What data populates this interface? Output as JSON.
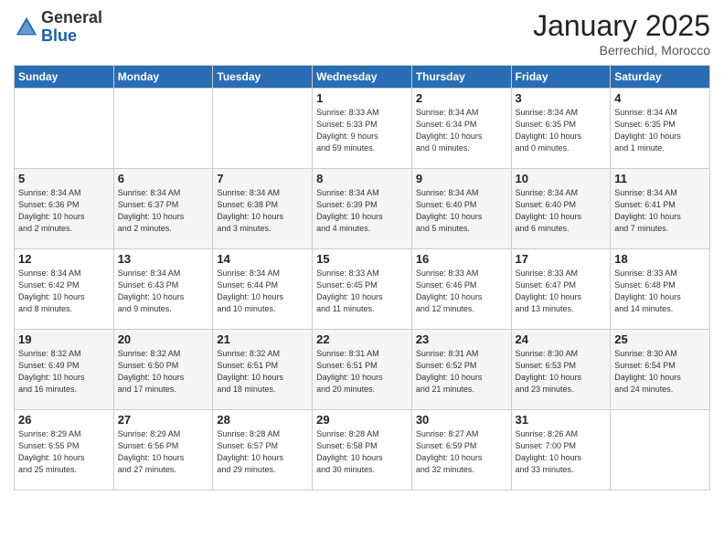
{
  "logo": {
    "general": "General",
    "blue": "Blue"
  },
  "header": {
    "month_year": "January 2025",
    "location": "Berrechid, Morocco"
  },
  "days_of_week": [
    "Sunday",
    "Monday",
    "Tuesday",
    "Wednesday",
    "Thursday",
    "Friday",
    "Saturday"
  ],
  "weeks": [
    [
      {
        "day": "",
        "info": ""
      },
      {
        "day": "",
        "info": ""
      },
      {
        "day": "",
        "info": ""
      },
      {
        "day": "1",
        "info": "Sunrise: 8:33 AM\nSunset: 6:33 PM\nDaylight: 9 hours\nand 59 minutes."
      },
      {
        "day": "2",
        "info": "Sunrise: 8:34 AM\nSunset: 6:34 PM\nDaylight: 10 hours\nand 0 minutes."
      },
      {
        "day": "3",
        "info": "Sunrise: 8:34 AM\nSunset: 6:35 PM\nDaylight: 10 hours\nand 0 minutes."
      },
      {
        "day": "4",
        "info": "Sunrise: 8:34 AM\nSunset: 6:35 PM\nDaylight: 10 hours\nand 1 minute."
      }
    ],
    [
      {
        "day": "5",
        "info": "Sunrise: 8:34 AM\nSunset: 6:36 PM\nDaylight: 10 hours\nand 2 minutes."
      },
      {
        "day": "6",
        "info": "Sunrise: 8:34 AM\nSunset: 6:37 PM\nDaylight: 10 hours\nand 2 minutes."
      },
      {
        "day": "7",
        "info": "Sunrise: 8:34 AM\nSunset: 6:38 PM\nDaylight: 10 hours\nand 3 minutes."
      },
      {
        "day": "8",
        "info": "Sunrise: 8:34 AM\nSunset: 6:39 PM\nDaylight: 10 hours\nand 4 minutes."
      },
      {
        "day": "9",
        "info": "Sunrise: 8:34 AM\nSunset: 6:40 PM\nDaylight: 10 hours\nand 5 minutes."
      },
      {
        "day": "10",
        "info": "Sunrise: 8:34 AM\nSunset: 6:40 PM\nDaylight: 10 hours\nand 6 minutes."
      },
      {
        "day": "11",
        "info": "Sunrise: 8:34 AM\nSunset: 6:41 PM\nDaylight: 10 hours\nand 7 minutes."
      }
    ],
    [
      {
        "day": "12",
        "info": "Sunrise: 8:34 AM\nSunset: 6:42 PM\nDaylight: 10 hours\nand 8 minutes."
      },
      {
        "day": "13",
        "info": "Sunrise: 8:34 AM\nSunset: 6:43 PM\nDaylight: 10 hours\nand 9 minutes."
      },
      {
        "day": "14",
        "info": "Sunrise: 8:34 AM\nSunset: 6:44 PM\nDaylight: 10 hours\nand 10 minutes."
      },
      {
        "day": "15",
        "info": "Sunrise: 8:33 AM\nSunset: 6:45 PM\nDaylight: 10 hours\nand 11 minutes."
      },
      {
        "day": "16",
        "info": "Sunrise: 8:33 AM\nSunset: 6:46 PM\nDaylight: 10 hours\nand 12 minutes."
      },
      {
        "day": "17",
        "info": "Sunrise: 8:33 AM\nSunset: 6:47 PM\nDaylight: 10 hours\nand 13 minutes."
      },
      {
        "day": "18",
        "info": "Sunrise: 8:33 AM\nSunset: 6:48 PM\nDaylight: 10 hours\nand 14 minutes."
      }
    ],
    [
      {
        "day": "19",
        "info": "Sunrise: 8:32 AM\nSunset: 6:49 PM\nDaylight: 10 hours\nand 16 minutes."
      },
      {
        "day": "20",
        "info": "Sunrise: 8:32 AM\nSunset: 6:50 PM\nDaylight: 10 hours\nand 17 minutes."
      },
      {
        "day": "21",
        "info": "Sunrise: 8:32 AM\nSunset: 6:51 PM\nDaylight: 10 hours\nand 18 minutes."
      },
      {
        "day": "22",
        "info": "Sunrise: 8:31 AM\nSunset: 6:51 PM\nDaylight: 10 hours\nand 20 minutes."
      },
      {
        "day": "23",
        "info": "Sunrise: 8:31 AM\nSunset: 6:52 PM\nDaylight: 10 hours\nand 21 minutes."
      },
      {
        "day": "24",
        "info": "Sunrise: 8:30 AM\nSunset: 6:53 PM\nDaylight: 10 hours\nand 23 minutes."
      },
      {
        "day": "25",
        "info": "Sunrise: 8:30 AM\nSunset: 6:54 PM\nDaylight: 10 hours\nand 24 minutes."
      }
    ],
    [
      {
        "day": "26",
        "info": "Sunrise: 8:29 AM\nSunset: 6:55 PM\nDaylight: 10 hours\nand 25 minutes."
      },
      {
        "day": "27",
        "info": "Sunrise: 8:29 AM\nSunset: 6:56 PM\nDaylight: 10 hours\nand 27 minutes."
      },
      {
        "day": "28",
        "info": "Sunrise: 8:28 AM\nSunset: 6:57 PM\nDaylight: 10 hours\nand 29 minutes."
      },
      {
        "day": "29",
        "info": "Sunrise: 8:28 AM\nSunset: 6:58 PM\nDaylight: 10 hours\nand 30 minutes."
      },
      {
        "day": "30",
        "info": "Sunrise: 8:27 AM\nSunset: 6:59 PM\nDaylight: 10 hours\nand 32 minutes."
      },
      {
        "day": "31",
        "info": "Sunrise: 8:26 AM\nSunset: 7:00 PM\nDaylight: 10 hours\nand 33 minutes."
      },
      {
        "day": "",
        "info": ""
      }
    ]
  ]
}
